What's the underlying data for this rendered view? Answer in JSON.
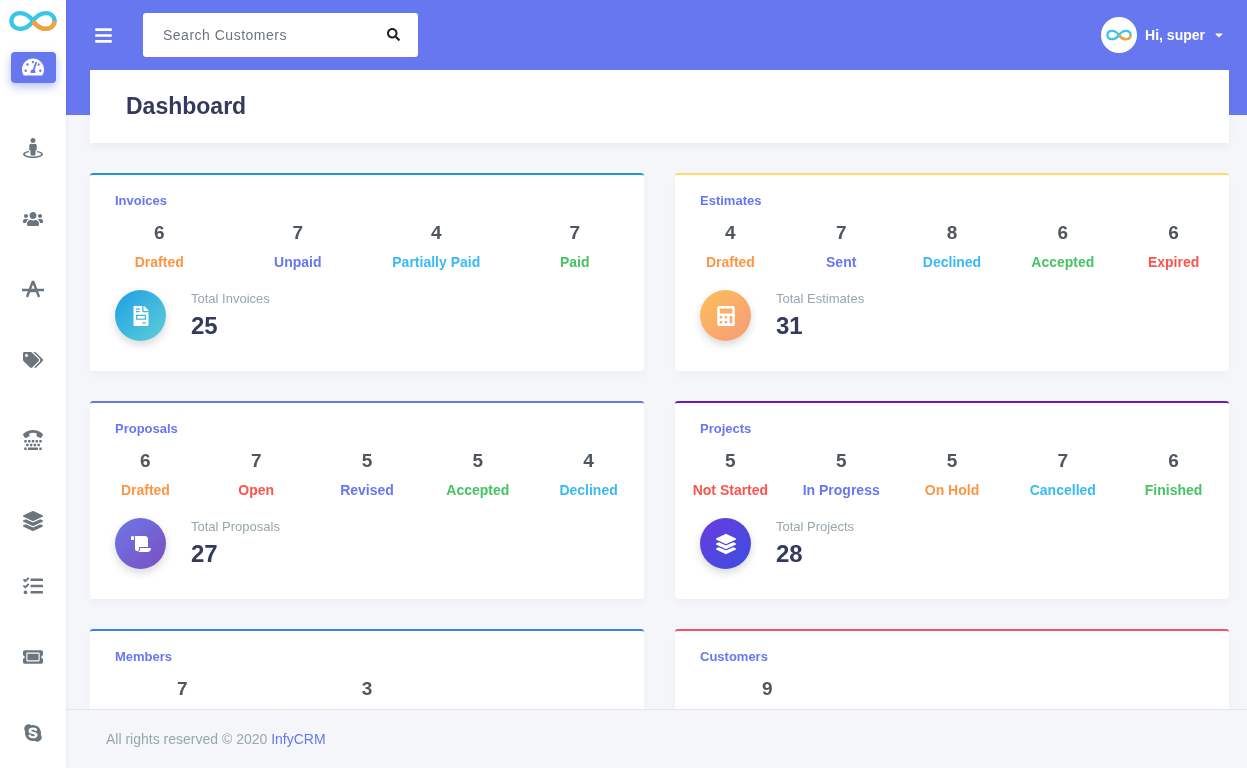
{
  "header": {
    "search": {
      "placeholder": "Search Customers"
    },
    "user": {
      "greeting": "Hi, super"
    }
  },
  "sidebar": {
    "items": [
      {
        "selected": true
      },
      {
        "selected": false
      },
      {
        "selected": false
      },
      {
        "selected": false
      },
      {
        "selected": false
      },
      {
        "selected": false
      },
      {
        "selected": false
      },
      {
        "selected": false
      },
      {
        "selected": false
      },
      {
        "selected": false
      }
    ]
  },
  "page_title": "Dashboard",
  "cards": [
    {
      "kind": "invoices",
      "title": "Invoices",
      "color": "#2196d3",
      "stats": [
        {
          "value": "6",
          "label": "Drafted",
          "color": "#fd9644"
        },
        {
          "value": "7",
          "label": "Unpaid",
          "color": "#6777ef"
        },
        {
          "value": "4",
          "label": "Partially Paid",
          "color": "#3abaf4"
        },
        {
          "value": "7",
          "label": "Paid",
          "color": "#47c363"
        }
      ],
      "total_label": "Total Invoices",
      "total": "25"
    },
    {
      "kind": "estimates",
      "title": "Estimates",
      "color": "#ffd86b",
      "stats": [
        {
          "value": "4",
          "label": "Drafted",
          "color": "#fd9644"
        },
        {
          "value": "7",
          "label": "Sent",
          "color": "#6777ef"
        },
        {
          "value": "8",
          "label": "Declined",
          "color": "#3abaf4"
        },
        {
          "value": "6",
          "label": "Accepted",
          "color": "#47c363"
        },
        {
          "value": "6",
          "label": "Expired",
          "color": "#fc544b"
        }
      ],
      "total_label": "Total Estimates",
      "total": "31"
    },
    {
      "kind": "proposals",
      "title": "Proposals",
      "color": "#6777ef",
      "stats": [
        {
          "value": "6",
          "label": "Drafted",
          "color": "#fd9644"
        },
        {
          "value": "7",
          "label": "Open",
          "color": "#fc544b"
        },
        {
          "value": "5",
          "label": "Revised",
          "color": "#6777ef"
        },
        {
          "value": "5",
          "label": "Accepted",
          "color": "#47c363"
        },
        {
          "value": "4",
          "label": "Declined",
          "color": "#3abaf4"
        }
      ],
      "total_label": "Total Proposals",
      "total": "27"
    },
    {
      "kind": "projects",
      "title": "Projects",
      "color": "#6a1bc4",
      "stats": [
        {
          "value": "5",
          "label": "Not Started",
          "color": "#fc544b"
        },
        {
          "value": "5",
          "label": "In Progress",
          "color": "#6777ef"
        },
        {
          "value": "5",
          "label": "On Hold",
          "color": "#fd9644"
        },
        {
          "value": "7",
          "label": "Cancelled",
          "color": "#3abaf4"
        },
        {
          "value": "6",
          "label": "Finished",
          "color": "#47c363"
        }
      ],
      "total_label": "Total Projects",
      "total": "28"
    },
    {
      "kind": "members",
      "title": "Members",
      "color": "#3f7ee8",
      "stats": [
        {
          "value": "7"
        },
        {
          "value": "3"
        }
      ]
    },
    {
      "kind": "customers",
      "title": "Customers",
      "color": "#f5506a",
      "stats": [
        {
          "value": "9"
        }
      ]
    }
  ],
  "footer": {
    "text": "All rights reserved © 2020",
    "link": "InfyCRM"
  }
}
